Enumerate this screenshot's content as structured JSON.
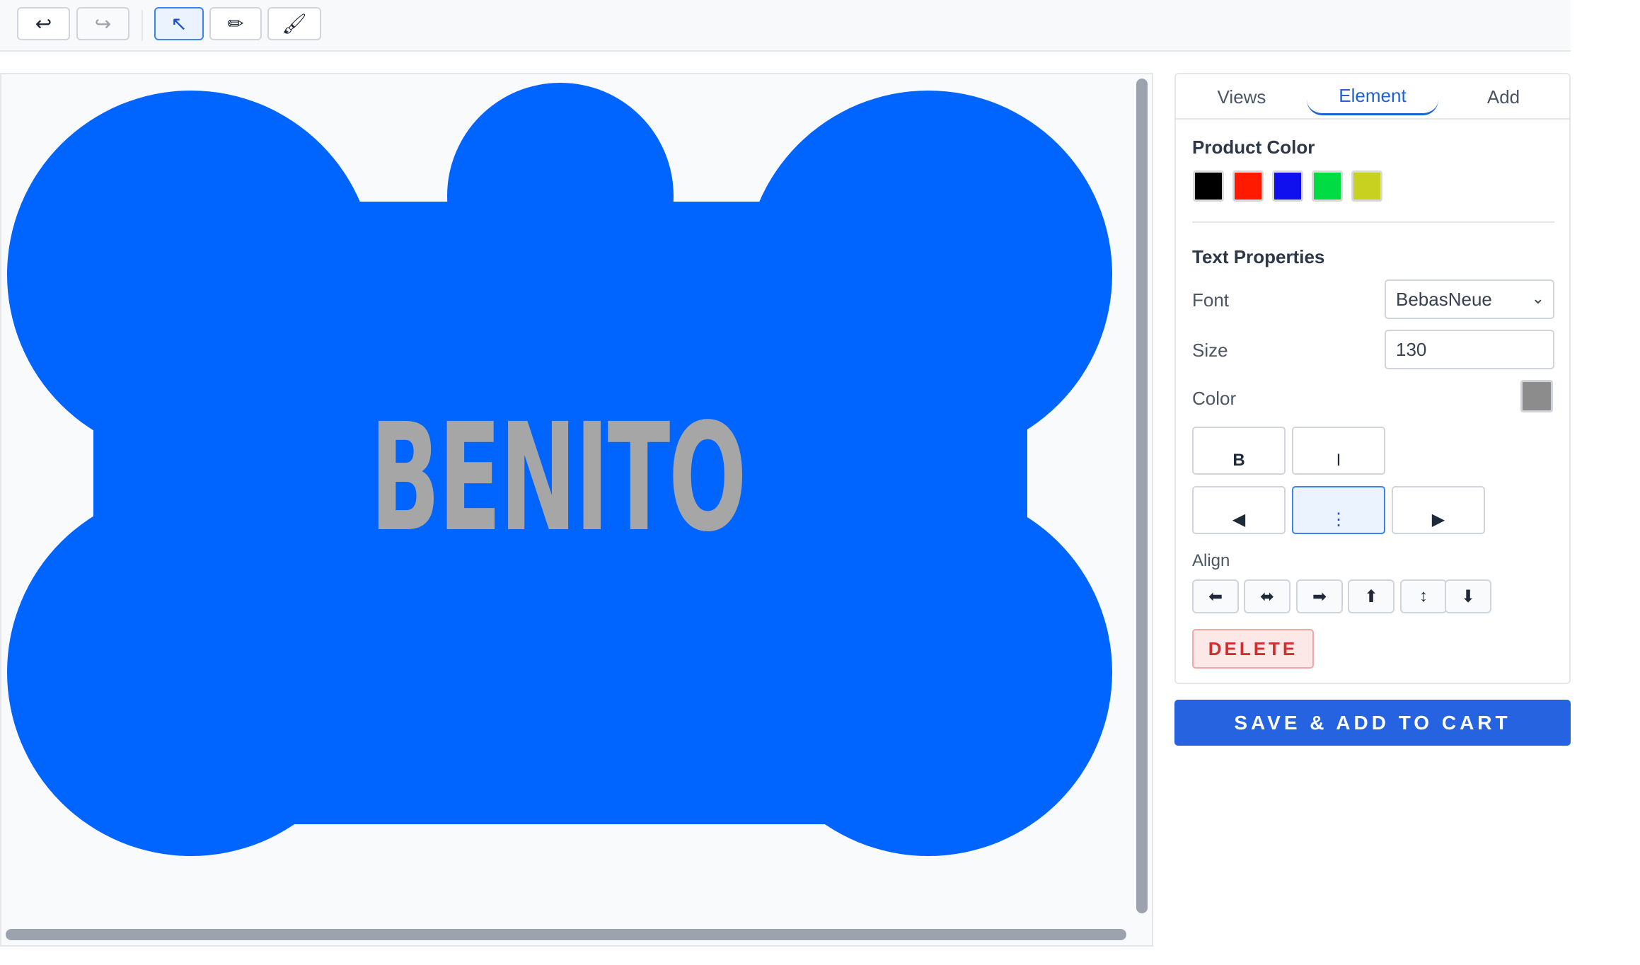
{
  "toolbar": {
    "undo_icon": "↩",
    "redo_icon": "↪",
    "select_icon": "↖",
    "pen_icon": "✏",
    "brush_icon": "🖌"
  },
  "canvas": {
    "product_color": "#0064ff",
    "text": "BENITO",
    "text_color": "#a6a6a6"
  },
  "panel": {
    "tabs": [
      {
        "label": "Views"
      },
      {
        "label": "Element"
      },
      {
        "label": "Add"
      }
    ],
    "active_tab": "Element",
    "product_color_title": "Product Color",
    "swatches": [
      "#000000",
      "#ff1a00",
      "#1010ee",
      "#00dd44",
      "#c8d020"
    ],
    "text_properties_title": "Text Properties",
    "font_label": "Font",
    "font_value": "BebasNeue",
    "size_label": "Size",
    "size_value": "130",
    "color_label": "Color",
    "color_value": "#8c8c8c",
    "bold_label": "B",
    "italic_label": "I",
    "align_left_text": "◀",
    "align_center_text": "⋮",
    "align_right_text": "▶",
    "align_title": "Align",
    "align_icons": [
      "⬅",
      "⬌",
      "➡",
      "⬆",
      "↕",
      "⬇"
    ],
    "delete_label": "DELETE"
  },
  "cart_button_label": "SAVE & ADD TO CART"
}
